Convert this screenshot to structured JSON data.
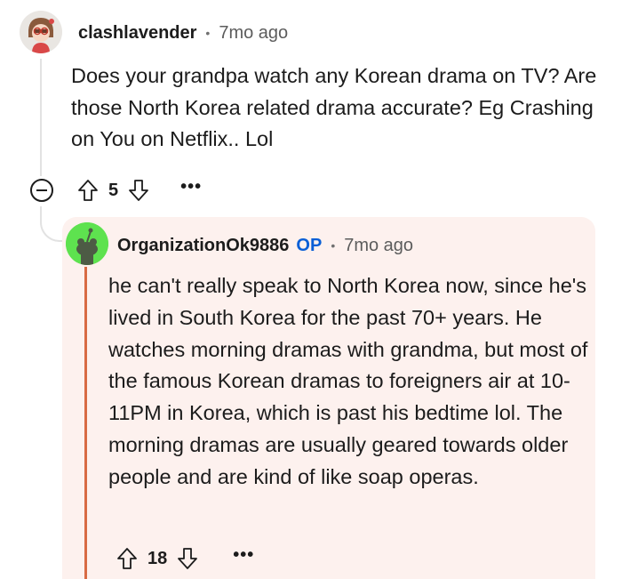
{
  "parent_comment": {
    "username": "clashlavender",
    "separator": "•",
    "time": "7mo ago",
    "body": "Does your grandpa watch any Korean drama on TV? Are those North Korea related drama accurate? Eg Crashing on You on Netflix.. Lol",
    "score": "5",
    "more": "•••",
    "avatar_icon": "cartoon-girl-avatar-icon"
  },
  "reply": {
    "username": "OrganizationOk9886",
    "op_badge": "OP",
    "separator": "•",
    "time": "7mo ago",
    "body": "he can't really speak to North Korea now, since he's lived in South Korea for the past 70+ years. He watches morning dramas with grandma, but most of the famous Korean dramas to foreigners air at 10-11PM in Korea, which is past his bedtime lol. The morning dramas are usually geared towards older people and are kind of like soap operas.",
    "score": "18",
    "more": "•••",
    "avatar_icon": "snoo-avatar-icon",
    "avatar_color": "#5ee24f",
    "highlight_color": "#d86b44"
  }
}
